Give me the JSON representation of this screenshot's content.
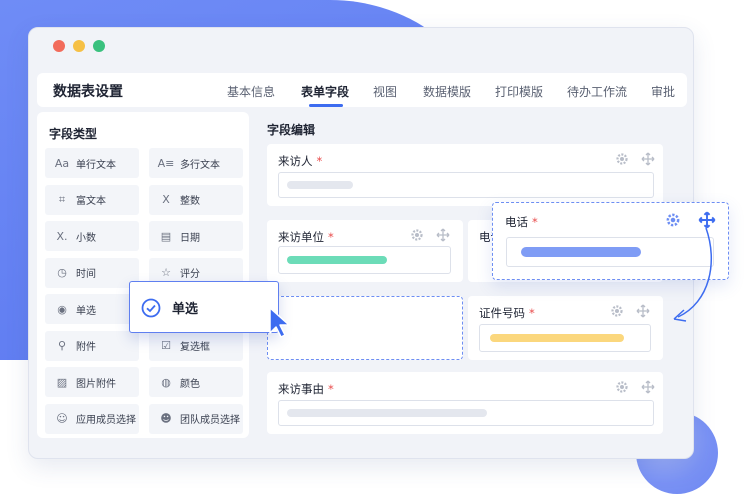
{
  "window": {
    "traffic_lights": [
      "#f26b5b",
      "#f6c045",
      "#3ac17e"
    ],
    "accent": "#3d6cf0"
  },
  "header": {
    "title": "数据表设置",
    "tabs": [
      "基本信息",
      "表单字段",
      "视图",
      "数据模版",
      "打印模版",
      "待办工作流",
      "审批"
    ],
    "active_tab": "表单字段"
  },
  "field_types": {
    "title": "字段类型",
    "items": [
      {
        "label": "单行文本",
        "icon": "text-icon"
      },
      {
        "label": "多行文本",
        "icon": "multiline-text-icon"
      },
      {
        "label": "富文本",
        "icon": "rich-text-icon"
      },
      {
        "label": "整数",
        "icon": "integer-icon"
      },
      {
        "label": "小数",
        "icon": "decimal-icon"
      },
      {
        "label": "日期",
        "icon": "calendar-icon"
      },
      {
        "label": "时间",
        "icon": "clock-icon"
      },
      {
        "label": "评分",
        "icon": "star-icon"
      },
      {
        "label": "单选",
        "icon": "radio-icon"
      },
      {
        "label": "",
        "icon": ""
      },
      {
        "label": "附件",
        "icon": "paperclip-icon"
      },
      {
        "label": "复选框",
        "icon": "checkbox-icon"
      },
      {
        "label": "图片附件",
        "icon": "image-icon"
      },
      {
        "label": "颜色",
        "icon": "palette-icon"
      },
      {
        "label": "应用成员选择",
        "icon": "member-icon"
      },
      {
        "label": "团队成员选择",
        "icon": "team-icon"
      }
    ],
    "icon_glyphs": [
      "Aa",
      "A≡",
      "⌗",
      "X",
      "X.",
      "▤",
      "◷",
      "☆",
      "◉",
      "",
      "⚲",
      "☑",
      "▨",
      "◍",
      "☺",
      "☻"
    ]
  },
  "editor": {
    "title": "字段编辑",
    "fields": {
      "visitor": {
        "label": "来访人",
        "required": "*"
      },
      "company": {
        "label": "来访单位",
        "required": "*"
      },
      "phone_placeholder": {
        "label": "电话"
      },
      "id_number": {
        "label": "证件号码",
        "required": "*"
      },
      "reason": {
        "label": "来访事由",
        "required": "*"
      }
    },
    "bar_colors": {
      "grey": "#e4e7ee",
      "green": "#6cdcb8",
      "yellow": "#fbd77d",
      "blue": "#7f9cf5"
    }
  },
  "drag": {
    "phone_card": {
      "label": "电话",
      "required": "*"
    },
    "radio_choice": {
      "label": "单选"
    }
  }
}
